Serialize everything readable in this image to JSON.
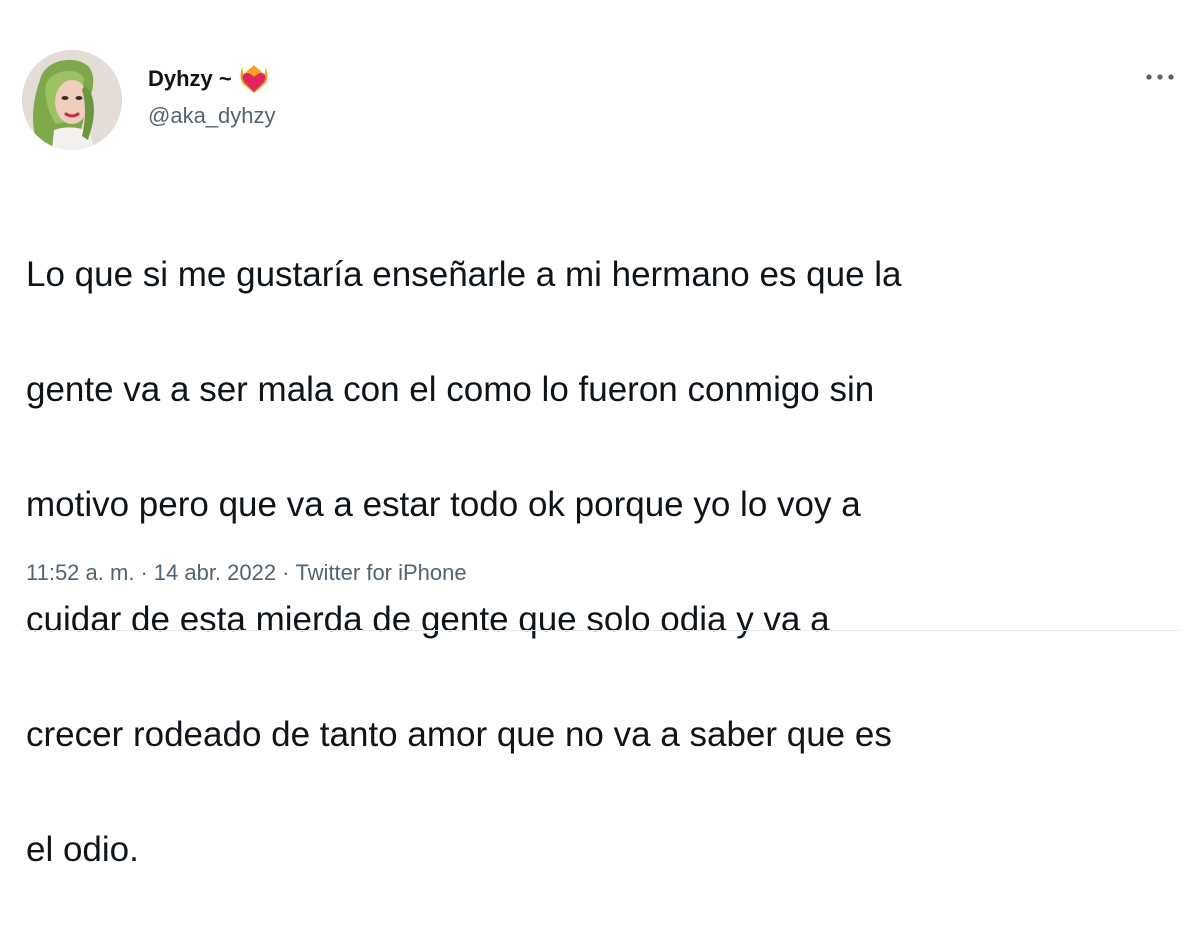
{
  "author": {
    "display_name": "Dyhzy ~",
    "handle": "@aka_dyhzy",
    "name_emoji_icon": "heart-on-fire-icon"
  },
  "tweet": {
    "text_lines": [
      "Lo que si me gustaría enseñarle a mi hermano es que la",
      "gente va a ser mala con el como lo fueron conmigo sin",
      "motivo pero que va a estar todo ok porque yo lo voy a",
      "cuidar de esta mierda de gente que solo odia y va a",
      "crecer rodeado de tanto amor que no va a saber que es",
      "el odio."
    ]
  },
  "meta": {
    "time": "11:52 a. m.",
    "separator": "·",
    "date": "14 abr. 2022",
    "source": "Twitter for iPhone"
  },
  "colors": {
    "text_primary": "#0f1419",
    "text_secondary": "#536471",
    "divider": "#e6ecf0"
  },
  "icons": {
    "more": "more-horizontal-icon"
  }
}
